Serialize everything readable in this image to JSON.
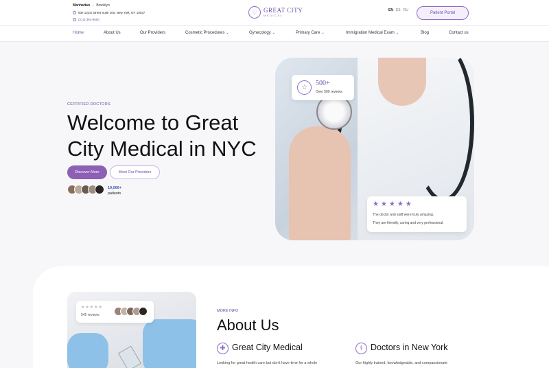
{
  "topbar": {
    "locations": [
      "Manhattan",
      "Brooklyn"
    ],
    "address": "63e 131st Street Suite 100, New York, NY 10037",
    "phone": "(212) 391-9500",
    "logo_title": "GREAT CITY",
    "logo_sub": "MEDICAL",
    "languages": [
      "EN",
      "ES",
      "RU"
    ],
    "portal_label": "Patient Portal"
  },
  "nav": {
    "items": [
      "Home",
      "About Us",
      "Our Providers",
      "Cosmetic Procedures",
      "Gynecology",
      "Primary Care",
      "Immigration Medical Exam",
      "Blog",
      "Contact us"
    ]
  },
  "hero": {
    "eyebrow": "CERTIFIED DOCTORS",
    "title": "Welcome to Great City Medical in NYC",
    "discover_label": "Discover More",
    "meet_label": "Meet Our Providers",
    "patients_num": "10,000+",
    "patients_label": "patients",
    "badge_num": "500+",
    "badge_label": "Over 500 reviews",
    "stars": "★★★★★",
    "review_line1": "The doctor and staff were truly amazing.",
    "review_line2": "They are friendly, caring and very professional."
  },
  "about": {
    "mini_stars": "★★★★★",
    "mini_count": "545 reviews",
    "eyebrow": "MORE INFO",
    "title": "About Us",
    "feature1_title": "Great City Medical",
    "feature1_text": "Looking for great health care but don't have time for a whole",
    "feature2_title": "Doctors in New York",
    "feature2_text": "Our highly trained, knowledgeable, and compassionate"
  },
  "colors": {
    "accent": "#8d5fb5",
    "accent_dark": "#6b4fa6"
  }
}
